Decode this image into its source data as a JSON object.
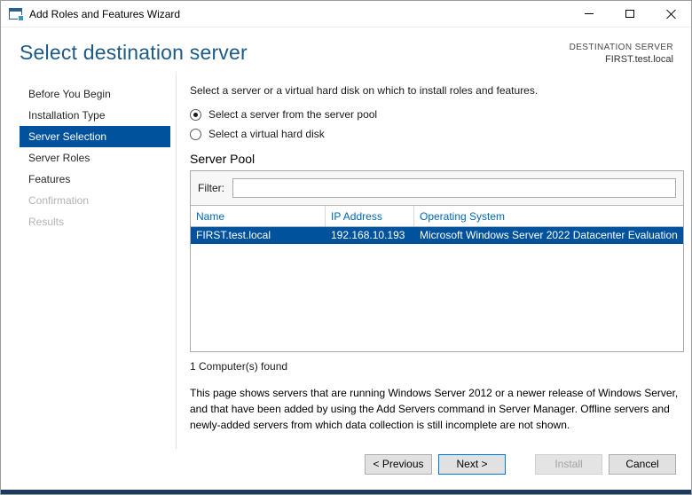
{
  "colors": {
    "accent_blue": "#00529c",
    "title_blue": "#1d5a87",
    "table_header_blue": "#0066b4",
    "default_button_border": "#0078d7",
    "bottom_strip": "#1c3a5e"
  },
  "window": {
    "title": "Add Roles and Features Wizard"
  },
  "header": {
    "title": "Select destination server",
    "destination_label": "DESTINATION SERVER",
    "destination_server": "FIRST.test.local"
  },
  "sidebar": {
    "items": [
      {
        "label": "Before You Begin",
        "state": "enabled"
      },
      {
        "label": "Installation Type",
        "state": "enabled"
      },
      {
        "label": "Server Selection",
        "state": "selected"
      },
      {
        "label": "Server Roles",
        "state": "enabled"
      },
      {
        "label": "Features",
        "state": "enabled"
      },
      {
        "label": "Confirmation",
        "state": "disabled"
      },
      {
        "label": "Results",
        "state": "disabled"
      }
    ]
  },
  "main": {
    "intro": "Select a server or a virtual hard disk on which to install roles and features.",
    "radios": {
      "server_pool": "Select a server from the server pool",
      "vhd": "Select a virtual hard disk",
      "selected": "server_pool"
    },
    "server_pool": {
      "title": "Server Pool",
      "filter_label": "Filter:",
      "filter_value": "",
      "columns": [
        "Name",
        "IP Address",
        "Operating System"
      ],
      "rows": [
        {
          "name": "FIRST.test.local",
          "ip": "192.168.10.193",
          "os": "Microsoft Windows Server 2022 Datacenter Evaluation",
          "selected": true
        }
      ],
      "found_text": "1 Computer(s) found"
    },
    "description": "This page shows servers that are running Windows Server 2012 or a newer release of Windows Server, and that have been added by using the Add Servers command in Server Manager. Offline servers and newly-added servers from which data collection is still incomplete are not shown."
  },
  "footer": {
    "previous": "< Previous",
    "next": "Next >",
    "install": "Install",
    "cancel": "Cancel"
  }
}
